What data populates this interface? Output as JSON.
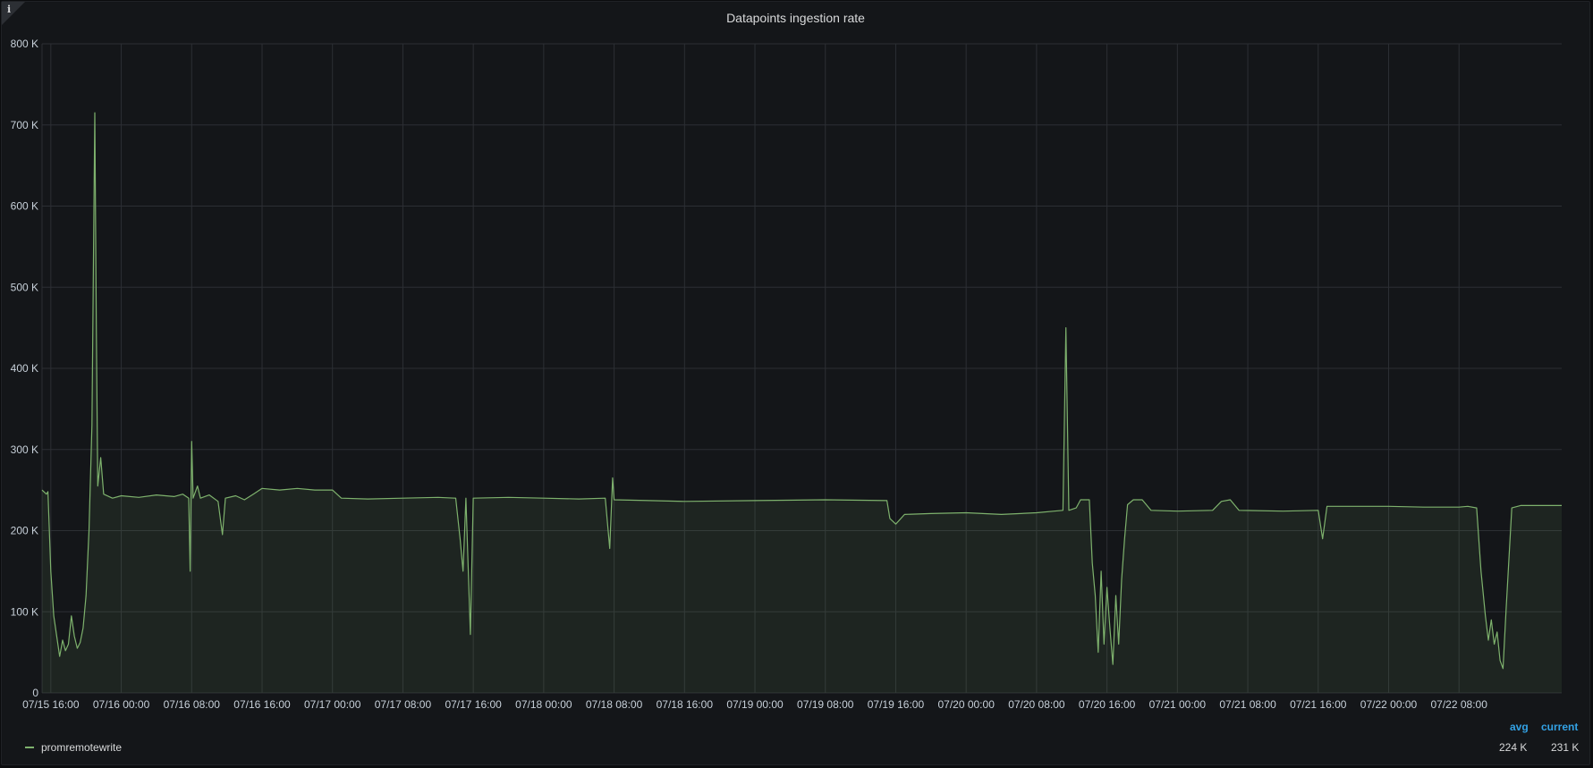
{
  "panel": {
    "title": "Datapoints ingestion rate",
    "info_icon": "info-icon"
  },
  "colors": {
    "background": "#141619",
    "grid": "#2c2f34",
    "series": "#7eb26d",
    "fill": "rgba(126,178,109,0.1)",
    "text": "#c7d0d9",
    "legend_header": "#33a2e5"
  },
  "legend": {
    "headers": {
      "avg": "avg",
      "current": "current"
    },
    "rows": [
      {
        "name": "promremotewrite",
        "avg": "224 K",
        "current": "231 K"
      }
    ]
  },
  "chart_data": {
    "type": "area",
    "title": "Datapoints ingestion rate",
    "xlabel": "",
    "ylabel": "",
    "x_start": "07/15 15:00",
    "x_end": "07/22 19:40",
    "ylim": [
      0,
      800000
    ],
    "y_ticks": [
      {
        "value": 0,
        "label": "0"
      },
      {
        "value": 100000,
        "label": "100 K"
      },
      {
        "value": 200000,
        "label": "200 K"
      },
      {
        "value": 300000,
        "label": "300 K"
      },
      {
        "value": 400000,
        "label": "400 K"
      },
      {
        "value": 500000,
        "label": "500 K"
      },
      {
        "value": 600000,
        "label": "600 K"
      },
      {
        "value": 700000,
        "label": "700 K"
      },
      {
        "value": 800000,
        "label": "800 K"
      }
    ],
    "x_ticks": [
      "07/15 16:00",
      "07/16 00:00",
      "07/16 08:00",
      "07/16 16:00",
      "07/17 00:00",
      "07/17 08:00",
      "07/17 16:00",
      "07/18 00:00",
      "07/18 08:00",
      "07/18 16:00",
      "07/19 00:00",
      "07/19 08:00",
      "07/19 16:00",
      "07/20 00:00",
      "07/20 08:00",
      "07/20 16:00",
      "07/21 00:00",
      "07/21 08:00",
      "07/21 16:00",
      "07/22 00:00",
      "07/22 08:00"
    ],
    "grid": true,
    "legend": "bottom",
    "series": [
      {
        "name": "promremotewrite",
        "points": [
          [
            "07/15 15:00",
            250000
          ],
          [
            "07/15 15:30",
            245000
          ],
          [
            "07/15 15:40",
            248000
          ],
          [
            "07/15 16:00",
            150000
          ],
          [
            "07/15 16:20",
            95000
          ],
          [
            "07/15 16:40",
            70000
          ],
          [
            "07/15 17:00",
            45000
          ],
          [
            "07/15 17:20",
            65000
          ],
          [
            "07/15 17:40",
            52000
          ],
          [
            "07/15 18:00",
            60000
          ],
          [
            "07/15 18:20",
            95000
          ],
          [
            "07/15 18:40",
            70000
          ],
          [
            "07/15 19:00",
            55000
          ],
          [
            "07/15 19:20",
            62000
          ],
          [
            "07/15 19:40",
            80000
          ],
          [
            "07/15 20:00",
            120000
          ],
          [
            "07/15 20:20",
            200000
          ],
          [
            "07/15 20:40",
            330000
          ],
          [
            "07/15 21:00",
            715000
          ],
          [
            "07/15 21:10",
            450000
          ],
          [
            "07/15 21:20",
            255000
          ],
          [
            "07/15 21:40",
            290000
          ],
          [
            "07/15 22:00",
            245000
          ],
          [
            "07/15 23:00",
            240000
          ],
          [
            "07/16 00:00",
            243000
          ],
          [
            "07/16 02:00",
            241000
          ],
          [
            "07/16 04:00",
            244000
          ],
          [
            "07/16 06:00",
            242000
          ],
          [
            "07/16 07:00",
            245000
          ],
          [
            "07/16 07:40",
            240000
          ],
          [
            "07/16 07:50",
            150000
          ],
          [
            "07/16 08:00",
            310000
          ],
          [
            "07/16 08:10",
            240000
          ],
          [
            "07/16 08:40",
            255000
          ],
          [
            "07/16 09:00",
            240000
          ],
          [
            "07/16 10:00",
            244000
          ],
          [
            "07/16 11:00",
            236000
          ],
          [
            "07/16 11:30",
            195000
          ],
          [
            "07/16 11:50",
            240000
          ],
          [
            "07/16 13:00",
            243000
          ],
          [
            "07/16 14:00",
            238000
          ],
          [
            "07/16 15:00",
            245000
          ],
          [
            "07/16 16:00",
            252000
          ],
          [
            "07/16 18:00",
            250000
          ],
          [
            "07/16 20:00",
            252000
          ],
          [
            "07/16 22:00",
            250000
          ],
          [
            "07/17 00:00",
            250000
          ],
          [
            "07/17 01:00",
            240000
          ],
          [
            "07/17 04:00",
            239000
          ],
          [
            "07/17 08:00",
            240000
          ],
          [
            "07/17 12:00",
            241000
          ],
          [
            "07/17 14:00",
            240000
          ],
          [
            "07/17 14:30",
            190000
          ],
          [
            "07/17 14:50",
            150000
          ],
          [
            "07/17 15:10",
            240000
          ],
          [
            "07/17 15:40",
            72000
          ],
          [
            "07/17 16:00",
            240000
          ],
          [
            "07/17 20:00",
            241000
          ],
          [
            "07/18 00:00",
            240000
          ],
          [
            "07/18 04:00",
            239000
          ],
          [
            "07/18 07:00",
            240000
          ],
          [
            "07/18 07:30",
            178000
          ],
          [
            "07/18 07:50",
            265000
          ],
          [
            "07/18 08:00",
            238000
          ],
          [
            "07/18 12:00",
            237000
          ],
          [
            "07/18 16:00",
            236000
          ],
          [
            "07/19 00:00",
            237000
          ],
          [
            "07/19 08:00",
            238000
          ],
          [
            "07/19 15:00",
            237000
          ],
          [
            "07/19 15:20",
            215000
          ],
          [
            "07/19 16:00",
            208000
          ],
          [
            "07/19 17:00",
            220000
          ],
          [
            "07/19 20:00",
            221000
          ],
          [
            "07/20 00:00",
            222000
          ],
          [
            "07/20 04:00",
            220000
          ],
          [
            "07/20 08:00",
            222000
          ],
          [
            "07/20 10:00",
            224000
          ],
          [
            "07/20 11:00",
            225000
          ],
          [
            "07/20 11:20",
            450000
          ],
          [
            "07/20 11:40",
            225000
          ],
          [
            "07/20 12:30",
            228000
          ],
          [
            "07/20 13:00",
            238000
          ],
          [
            "07/20 14:00",
            238000
          ],
          [
            "07/20 14:20",
            160000
          ],
          [
            "07/20 14:40",
            120000
          ],
          [
            "07/20 15:00",
            50000
          ],
          [
            "07/20 15:20",
            150000
          ],
          [
            "07/20 15:40",
            60000
          ],
          [
            "07/20 16:00",
            130000
          ],
          [
            "07/20 16:20",
            80000
          ],
          [
            "07/20 16:40",
            35000
          ],
          [
            "07/20 17:00",
            120000
          ],
          [
            "07/20 17:20",
            60000
          ],
          [
            "07/20 17:40",
            140000
          ],
          [
            "07/20 18:00",
            190000
          ],
          [
            "07/20 18:20",
            232000
          ],
          [
            "07/20 19:00",
            238000
          ],
          [
            "07/20 20:00",
            238000
          ],
          [
            "07/20 21:00",
            225000
          ],
          [
            "07/21 00:00",
            224000
          ],
          [
            "07/21 04:00",
            225000
          ],
          [
            "07/21 05:00",
            236000
          ],
          [
            "07/21 06:00",
            238000
          ],
          [
            "07/21 07:00",
            225000
          ],
          [
            "07/21 12:00",
            224000
          ],
          [
            "07/21 16:00",
            225000
          ],
          [
            "07/21 16:30",
            190000
          ],
          [
            "07/21 17:00",
            230000
          ],
          [
            "07/22 00:00",
            230000
          ],
          [
            "07/22 04:00",
            229000
          ],
          [
            "07/22 08:00",
            229000
          ],
          [
            "07/22 09:00",
            230000
          ],
          [
            "07/22 10:00",
            228000
          ],
          [
            "07/22 10:30",
            150000
          ],
          [
            "07/22 11:00",
            95000
          ],
          [
            "07/22 11:20",
            65000
          ],
          [
            "07/22 11:40",
            90000
          ],
          [
            "07/22 12:00",
            60000
          ],
          [
            "07/22 12:20",
            75000
          ],
          [
            "07/22 12:40",
            40000
          ],
          [
            "07/22 13:00",
            30000
          ],
          [
            "07/22 13:20",
            100000
          ],
          [
            "07/22 14:00",
            228000
          ],
          [
            "07/22 15:00",
            231000
          ],
          [
            "07/22 19:40",
            231000
          ]
        ]
      }
    ]
  }
}
